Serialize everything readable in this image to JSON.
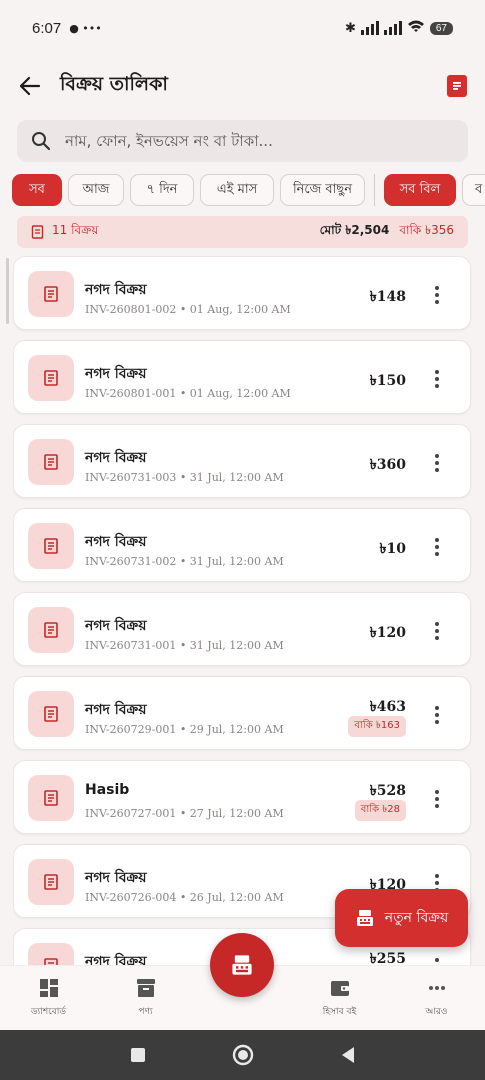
{
  "status": {
    "time": "6:07",
    "battery": "67"
  },
  "header": {
    "title": "বিক্রয় তালিকা"
  },
  "search": {
    "placeholder": "নাম, ফোন, ইনভয়েস নং বা টাকা..."
  },
  "filters": {
    "chips": [
      "সব",
      "আজ",
      "৭ দিন",
      "এই মাস",
      "নিজে বাছুন"
    ],
    "type_chips": [
      "সব বিল",
      "ব"
    ]
  },
  "summary": {
    "count": "11 বিক্রয়",
    "total": "মোট ৳2,504",
    "due": "বাকি ৳356"
  },
  "sales": [
    {
      "name": "নগদ বিক্রয়",
      "invoice": "INV-260801-002 • 01 Aug, 12:00 AM",
      "amount": "৳148",
      "due": ""
    },
    {
      "name": "নগদ বিক্রয়",
      "invoice": "INV-260801-001 • 01 Aug, 12:00 AM",
      "amount": "৳150",
      "due": ""
    },
    {
      "name": "নগদ বিক্রয়",
      "invoice": "INV-260731-003 • 31 Jul, 12:00 AM",
      "amount": "৳360",
      "due": ""
    },
    {
      "name": "নগদ বিক্রয়",
      "invoice": "INV-260731-002 • 31 Jul, 12:00 AM",
      "amount": "৳10",
      "due": ""
    },
    {
      "name": "নগদ বিক্রয়",
      "invoice": "INV-260731-001 • 31 Jul, 12:00 AM",
      "amount": "৳120",
      "due": ""
    },
    {
      "name": "নগদ বিক্রয়",
      "invoice": "INV-260729-001 • 29 Jul, 12:00 AM",
      "amount": "৳463",
      "due": "বাকি ৳163"
    },
    {
      "name": "Hasib",
      "invoice": "INV-260727-001 • 27 Jul, 12:00 AM",
      "amount": "৳528",
      "due": "বাকি ৳28"
    },
    {
      "name": "নগদ বিক্রয়",
      "invoice": "INV-260726-004 • 26 Jul, 12:00 AM",
      "amount": "৳120",
      "due": ""
    },
    {
      "name": "নগদ বিক্রয়",
      "invoice": "",
      "amount": "৳255",
      "due": ""
    }
  ],
  "fab": {
    "label": "নতুন বিক্রয়"
  },
  "nav": {
    "dashboard": "ড্যাশবোর্ড",
    "products": "পণ্য",
    "ledger": "হিসাব বই",
    "more": "আরও"
  },
  "colors": {
    "primary": "#d32f2f",
    "primary_light": "#f8d8d6",
    "background": "#f7f3f3"
  }
}
